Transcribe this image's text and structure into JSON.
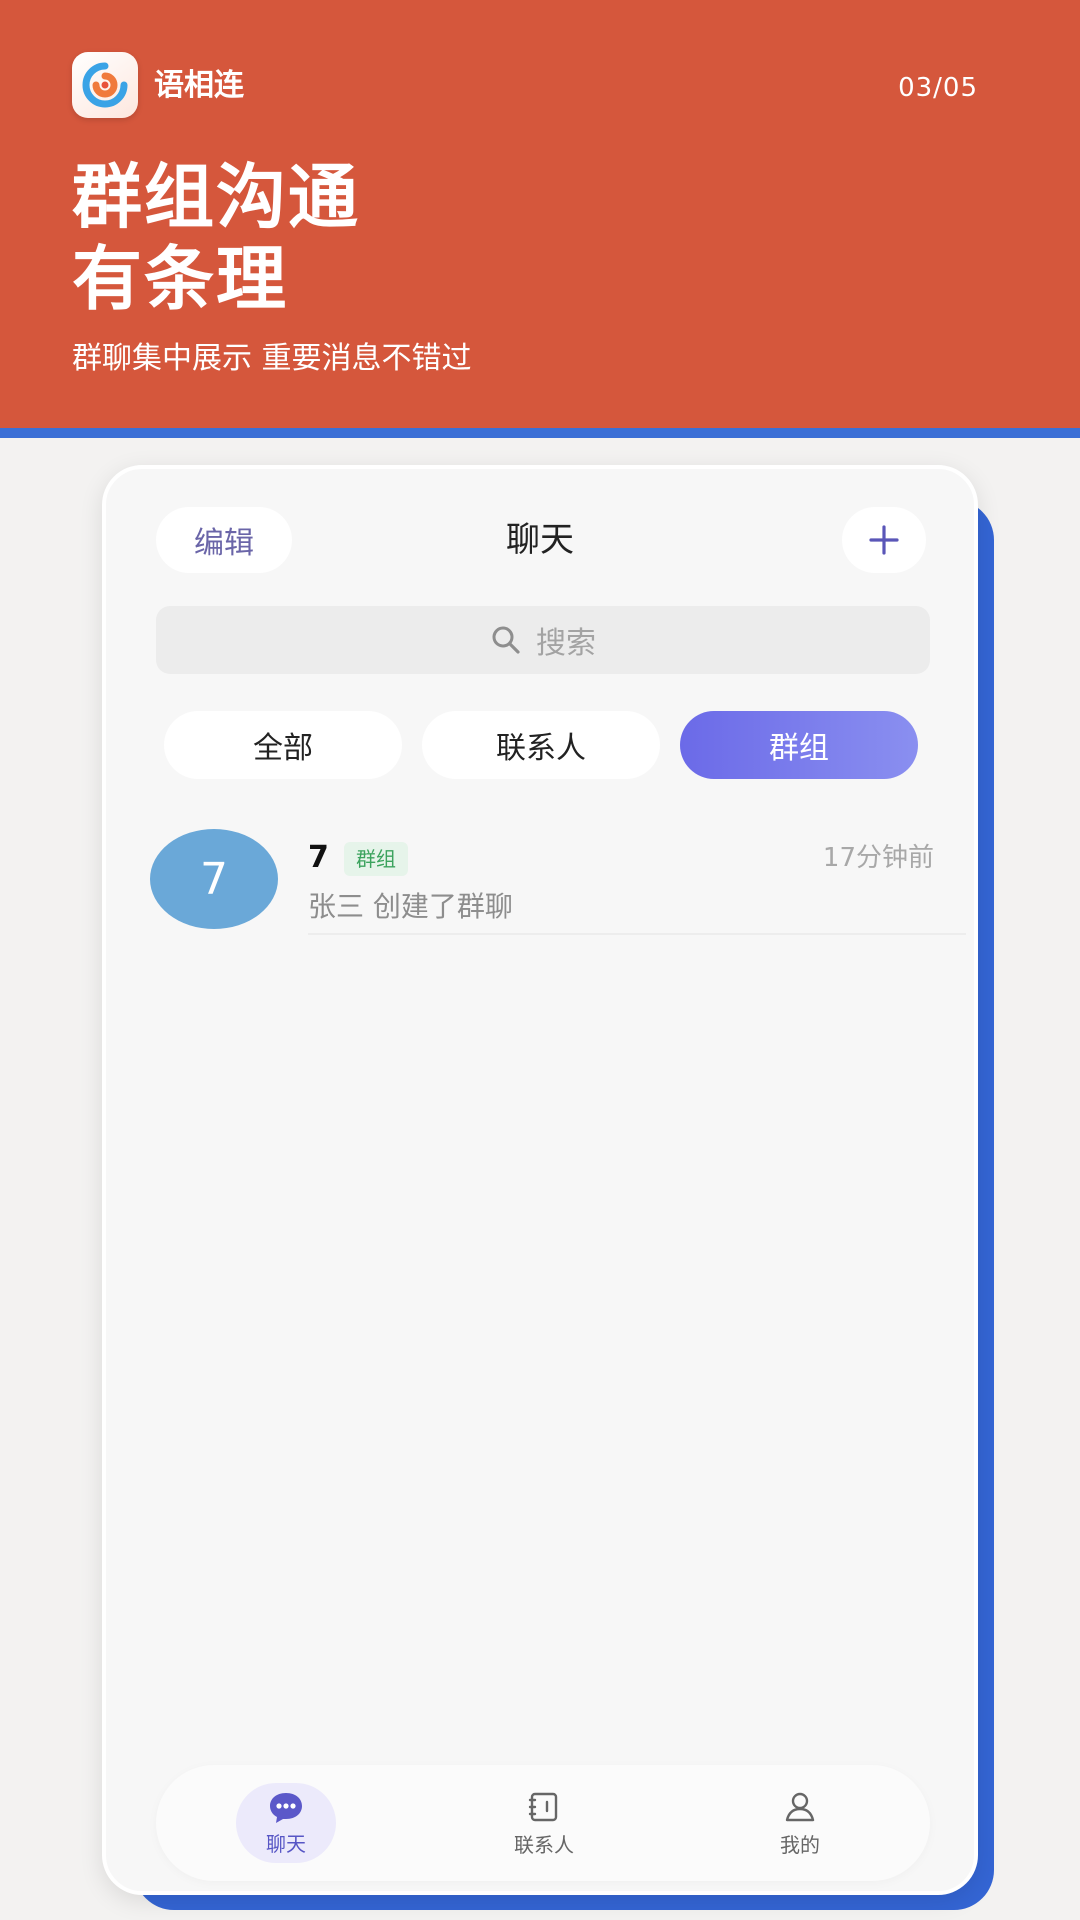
{
  "promo": {
    "app_name": "语相连",
    "page_counter": "03/05",
    "headline_line1": "群组沟通",
    "headline_line2": "有条理",
    "subheadline": "群聊集中展示 重要消息不错过"
  },
  "nav": {
    "edit_label": "编辑",
    "title": "聊天",
    "add_icon": "plus-icon"
  },
  "search": {
    "placeholder": "搜索",
    "icon": "search-icon"
  },
  "filter_tabs": [
    {
      "label": "全部",
      "selected": false
    },
    {
      "label": "联系人",
      "selected": false
    },
    {
      "label": "群组",
      "selected": true
    }
  ],
  "chats": [
    {
      "avatar_text": "7",
      "name": "7",
      "badge": "群组",
      "time": "17分钟前",
      "preview": "张三 创建了群聊"
    }
  ],
  "bottom_nav": [
    {
      "label": "聊天",
      "icon": "chat-bubble-icon",
      "active": true
    },
    {
      "label": "联系人",
      "icon": "address-book-icon",
      "active": false
    },
    {
      "label": "我的",
      "icon": "user-icon",
      "active": false
    }
  ],
  "colors": {
    "promo_background": "#d5573c",
    "accent_blue": "#3b6fd6",
    "tab_selected_start": "#6b6ae8",
    "tab_selected_end": "#8a8ff0",
    "avatar": "#6aa8d8",
    "badge_text": "#3ca35e"
  }
}
